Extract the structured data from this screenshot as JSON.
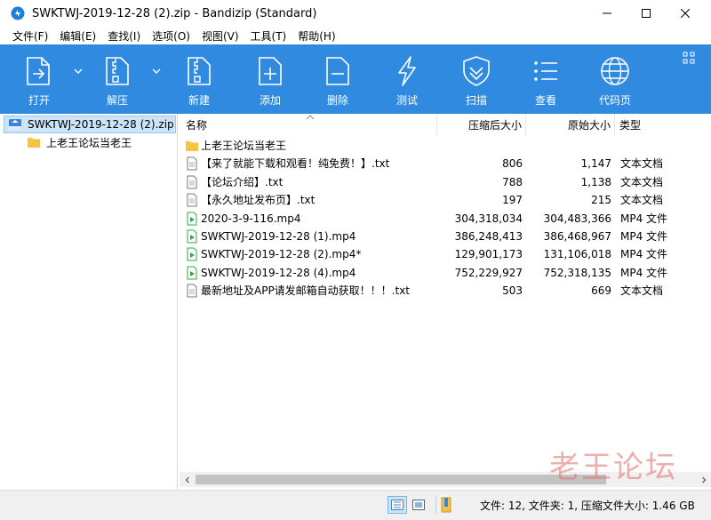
{
  "window": {
    "title": "SWKTWJ-2019-12-28 (2).zip - Bandizip (Standard)"
  },
  "menu": [
    "文件(F)",
    "编辑(E)",
    "查找(I)",
    "选项(O)",
    "视图(V)",
    "工具(T)",
    "帮助(H)"
  ],
  "toolbar": {
    "open": "打开",
    "extract": "解压",
    "new": "新建",
    "add": "添加",
    "delete": "删除",
    "test": "测试",
    "scan": "扫描",
    "view": "查看",
    "codepage": "代码页"
  },
  "tree": {
    "root": "SWKTWJ-2019-12-28 (2).zip",
    "child": "上老王论坛当老王"
  },
  "columns": {
    "name": "名称",
    "csize": "压缩后大小",
    "osize": "原始大小",
    "type": "类型"
  },
  "files": [
    {
      "icon": "folder-icon",
      "name": "上老王论坛当老王",
      "csize": "",
      "osize": "",
      "type": ""
    },
    {
      "icon": "text-file-icon",
      "name": "【来了就能下载和观看！纯免费！】.txt",
      "csize": "806",
      "osize": "1,147",
      "type": "文本文档"
    },
    {
      "icon": "text-file-icon",
      "name": "【论坛介绍】.txt",
      "csize": "788",
      "osize": "1,138",
      "type": "文本文档"
    },
    {
      "icon": "text-file-icon",
      "name": "【永久地址发布页】.txt",
      "csize": "197",
      "osize": "215",
      "type": "文本文档"
    },
    {
      "icon": "video-file-icon",
      "name": "2020-3-9-116.mp4",
      "csize": "304,318,034",
      "osize": "304,483,366",
      "type": "MP4 文件"
    },
    {
      "icon": "video-file-icon",
      "name": "SWKTWJ-2019-12-28 (1).mp4",
      "csize": "386,248,413",
      "osize": "386,468,967",
      "type": "MP4 文件"
    },
    {
      "icon": "video-file-icon",
      "name": "SWKTWJ-2019-12-28 (2).mp4*",
      "csize": "129,901,173",
      "osize": "131,106,018",
      "type": "MP4 文件"
    },
    {
      "icon": "video-file-icon",
      "name": "SWKTWJ-2019-12-28 (4).mp4",
      "csize": "752,229,927",
      "osize": "752,318,135",
      "type": "MP4 文件"
    },
    {
      "icon": "text-file-icon",
      "name": "最新地址及APP请发邮箱自动获取！！！.txt",
      "csize": "503",
      "osize": "669",
      "type": "文本文档"
    }
  ],
  "status": {
    "text": "文件: 12, 文件夹: 1, 压缩文件大小: 1.46 GB"
  },
  "watermark": "老王论坛",
  "colors": {
    "toolbar": "#2f8ae0",
    "selection": "#cce4f7",
    "folder": "#f5c542"
  }
}
